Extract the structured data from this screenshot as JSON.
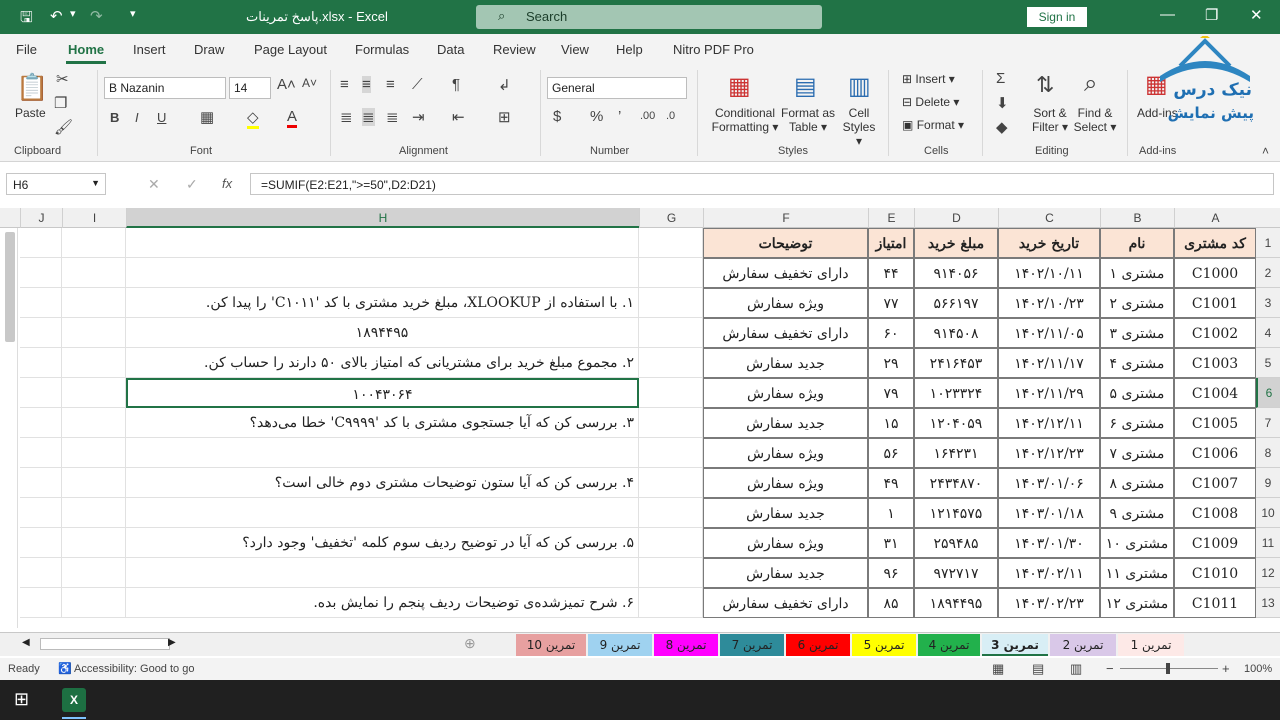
{
  "title": {
    "filename": "پاسخ تمرینات.xlsx",
    "sep": " - ",
    "app": "Excel",
    "search": "Search",
    "signin": "Sign in"
  },
  "tabs": [
    "File",
    "Home",
    "Insert",
    "Draw",
    "Page Layout",
    "Formulas",
    "Data",
    "Review",
    "View",
    "Help",
    "Nitro PDF Pro"
  ],
  "ribbon": {
    "clipboard": "Clipboard",
    "paste": "Paste",
    "font_group": "Font",
    "font_name": "B Nazanin",
    "font_size": "14",
    "alignment": "Alignment",
    "number": "Number",
    "number_format": "General",
    "styles": "Styles",
    "conditional": "Conditional",
    "formatting": "Formatting",
    "format_as": "Format as",
    "table": "Table",
    "cell": "Cell",
    "styles_btn": "Styles",
    "cells": "Cells",
    "insert": "Insert",
    "delete": "Delete",
    "format": "Format",
    "editing": "Editing",
    "sort": "Sort &",
    "filter": "Filter",
    "find": "Find &",
    "select": "Select",
    "addins": "Add-ins",
    "addins_btn": "Add-ins"
  },
  "namebox": "H6",
  "fx": "fx",
  "formula": "=SUMIF(E2:E21,\">=50\",D2:D21)",
  "columns": [
    "J",
    "I",
    "H",
    "G",
    "F",
    "E",
    "D",
    "C",
    "B",
    "A"
  ],
  "headers": [
    "کد مشتری",
    "نام",
    "تاریخ خرید",
    "مبلغ خرید",
    "امتیاز",
    "توضیحات"
  ],
  "rows": [
    {
      "n": "1"
    },
    {
      "n": "2",
      "a": "C1000",
      "b": "مشتری ۱",
      "c": "۱۴۰۲/۱۰/۱۱",
      "d": "۹۱۴۰۵۶",
      "e": "۴۴",
      "f": "دارای تخفیف سفارش"
    },
    {
      "n": "3",
      "a": "C1001",
      "b": "مشتری ۲",
      "c": "۱۴۰۲/۱۰/۲۳",
      "d": "۵۶۶۱۹۷",
      "e": "۷۷",
      "f": "ویژه سفارش",
      "h": "۱. با استفاده از XLOOKUP، مبلغ خرید مشتری با کد 'C۱۰۱۱' را پیدا کن."
    },
    {
      "n": "4",
      "a": "C1002",
      "b": "مشتری ۳",
      "c": "۱۴۰۲/۱۱/۰۵",
      "d": "۹۱۴۵۰۸",
      "e": "۶۰",
      "f": "دارای تخفیف سفارش",
      "h": "۱۸۹۴۴۹۵"
    },
    {
      "n": "5",
      "a": "C1003",
      "b": "مشتری ۴",
      "c": "۱۴۰۲/۱۱/۱۷",
      "d": "۲۴۱۶۴۵۳",
      "e": "۲۹",
      "f": "جدید سفارش",
      "h": "۲. مجموع مبلغ خرید برای مشتریانی که امتیاز بالای ۵۰ دارند را حساب کن."
    },
    {
      "n": "6",
      "a": "C1004",
      "b": "مشتری ۵",
      "c": "۱۴۰۲/۱۱/۲۹",
      "d": "۱۰۲۳۳۲۴",
      "e": "۷۹",
      "f": "ویژه        سفارش",
      "h": "۱۰۰۴۳۰۶۴"
    },
    {
      "n": "7",
      "a": "C1005",
      "b": "مشتری ۶",
      "c": "۱۴۰۲/۱۲/۱۱",
      "d": "۱۲۰۴۰۵۹",
      "e": "۱۵",
      "f": "جدید سفارش",
      "h": "۳. بررسی کن که آیا جستجوی مشتری با کد 'C۹۹۹۹' خطا می‌دهد؟"
    },
    {
      "n": "8",
      "a": "C1006",
      "b": "مشتری ۷",
      "c": "۱۴۰۲/۱۲/۲۳",
      "d": "۱۶۴۲۳۱",
      "e": "۵۶",
      "f": "ویژه سفارش"
    },
    {
      "n": "9",
      "a": "C1007",
      "b": "مشتری ۸",
      "c": "۱۴۰۳/۰۱/۰۶",
      "d": "۲۴۳۴۸۷۰",
      "e": "۴۹",
      "f": "ویژه سفارش",
      "h": "۴. بررسی کن که آیا ستون توضیحات مشتری دوم خالی است؟"
    },
    {
      "n": "10",
      "a": "C1008",
      "b": "مشتری ۹",
      "c": "۱۴۰۳/۰۱/۱۸",
      "d": "۱۲۱۴۵۷۵",
      "e": "۱",
      "f": "جدید سفارش"
    },
    {
      "n": "11",
      "a": "C1009",
      "b": "مشتری ۱۰",
      "c": "۱۴۰۳/۰۱/۳۰",
      "d": "۲۵۹۴۸۵",
      "e": "۳۱",
      "f": "ویژه سفارش",
      "h": "۵. بررسی کن که آیا در توضیح ردیف سوم کلمه 'تخفیف' وجود دارد؟"
    },
    {
      "n": "12",
      "a": "C1010",
      "b": "مشتری ۱۱",
      "c": "۱۴۰۳/۰۲/۱۱",
      "d": "۹۷۲۷۱۷",
      "e": "۹۶",
      "f": "جدید سفارش"
    },
    {
      "n": "13",
      "a": "C1011",
      "b": "مشتری ۱۲",
      "c": "۱۴۰۳/۰۲/۲۳",
      "d": "۱۸۹۴۴۹۵",
      "e": "۸۵",
      "f": "دارای تخفیف سفارش",
      "h": "۶. شرح تمیزشده‌ی توضیحات ردیف پنجم را نمایش بده."
    }
  ],
  "sheets": [
    {
      "name": "تمرین 1",
      "color": "#fde9e7"
    },
    {
      "name": "تمرین 2",
      "color": "#d9c8e8"
    },
    {
      "name": "تمرین 3",
      "color": "#d8eef5",
      "active": true
    },
    {
      "name": "تمرین 4",
      "color": "#22b14c"
    },
    {
      "name": "تمرین 5",
      "color": "#ffff00"
    },
    {
      "name": "تمرین 6",
      "color": "#ff0000"
    },
    {
      "name": "تمرین 7",
      "color": "#2e8b9a"
    },
    {
      "name": "تمرین 8",
      "color": "#ff00ff"
    },
    {
      "name": "تمرین 9",
      "color": "#9fd2f0"
    },
    {
      "name": "تمرین 10",
      "color": "#e7a0a0"
    }
  ],
  "status": {
    "ready": "Ready",
    "accessibility": "Accessibility: Good to go",
    "zoom": "100%"
  },
  "logo": {
    "line1": "نیک درس",
    "line2": "پیش نمایش"
  }
}
